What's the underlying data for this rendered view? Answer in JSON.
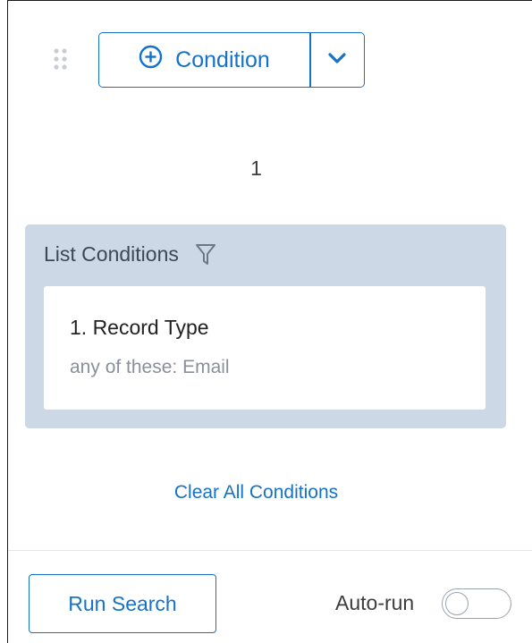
{
  "toolbar": {
    "add_condition_label": "Condition",
    "add_icon": "plus-circle-icon",
    "dropdown_icon": "chevron-down-icon",
    "drag_icon": "drag-handle-icon"
  },
  "counter": "1",
  "list_conditions": {
    "title": "List Conditions",
    "icon": "filter-icon",
    "items": [
      {
        "title": "1. Record Type",
        "description": "any of these: Email"
      }
    ]
  },
  "clear_all_label": "Clear All Conditions",
  "footer": {
    "run_search_label": "Run Search",
    "auto_run_label": "Auto-run",
    "auto_run_enabled": false
  },
  "colors": {
    "accent": "#1572c8",
    "card_background": "#ccd8e6"
  }
}
